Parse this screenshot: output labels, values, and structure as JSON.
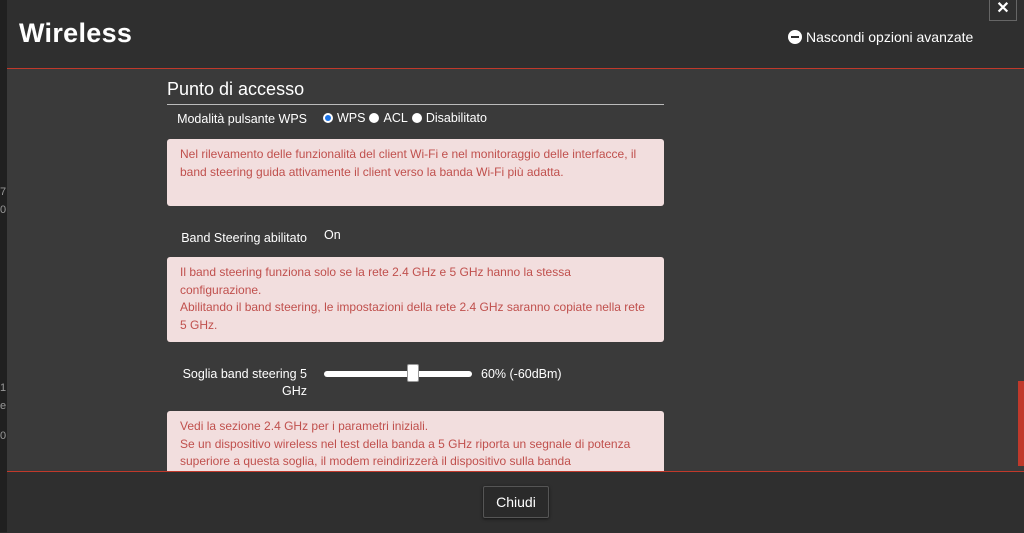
{
  "header": {
    "title": "Wireless",
    "advanced_toggle": "Nascondi opzioni avanzate",
    "close_symbol": "✕"
  },
  "section": {
    "title": "Punto di accesso"
  },
  "wps": {
    "label": "Modalità pulsante WPS",
    "options": [
      {
        "label": "WPS",
        "checked": true
      },
      {
        "label": "ACL",
        "checked": false
      },
      {
        "label": "Disabilitato",
        "checked": false
      }
    ]
  },
  "info1": {
    "text": "Nel rilevamento delle funzionalità del client Wi-Fi e nel monitoraggio delle interfacce, il band steering guida attivamente il client verso la banda Wi-Fi più adatta."
  },
  "band_steering": {
    "label": "Band Steering abilitato",
    "value": "On"
  },
  "info2": {
    "line1": "Il band steering funziona solo se la rete 2.4 GHz e 5 GHz hanno la stessa configurazione.",
    "line2": "Abilitando il band steering, le impostazioni della rete 2.4 GHz saranno copiate nella rete 5 GHz."
  },
  "threshold": {
    "label": "Soglia band steering 5 GHz",
    "value_text": "60% (-60dBm)",
    "level_percent": 60
  },
  "info3": {
    "line1": "Vedi la sezione 2.4 GHz per i parametri iniziali.",
    "line2": "Se un dispositivo wireless nel test della banda a 5 GHz riporta un segnale di potenza superiore a questa soglia, il modem reindirizzerà il dispositivo sulla banda"
  },
  "footer": {
    "close_label": "Chiudi"
  },
  "background_fragments": [
    "7",
    "0",
    "1",
    "e",
    "0"
  ],
  "colors": {
    "accent": "#c0392b",
    "info_bg": "#f2dede",
    "info_text": "#c0504d",
    "radio_checked": "#1a73e8"
  }
}
